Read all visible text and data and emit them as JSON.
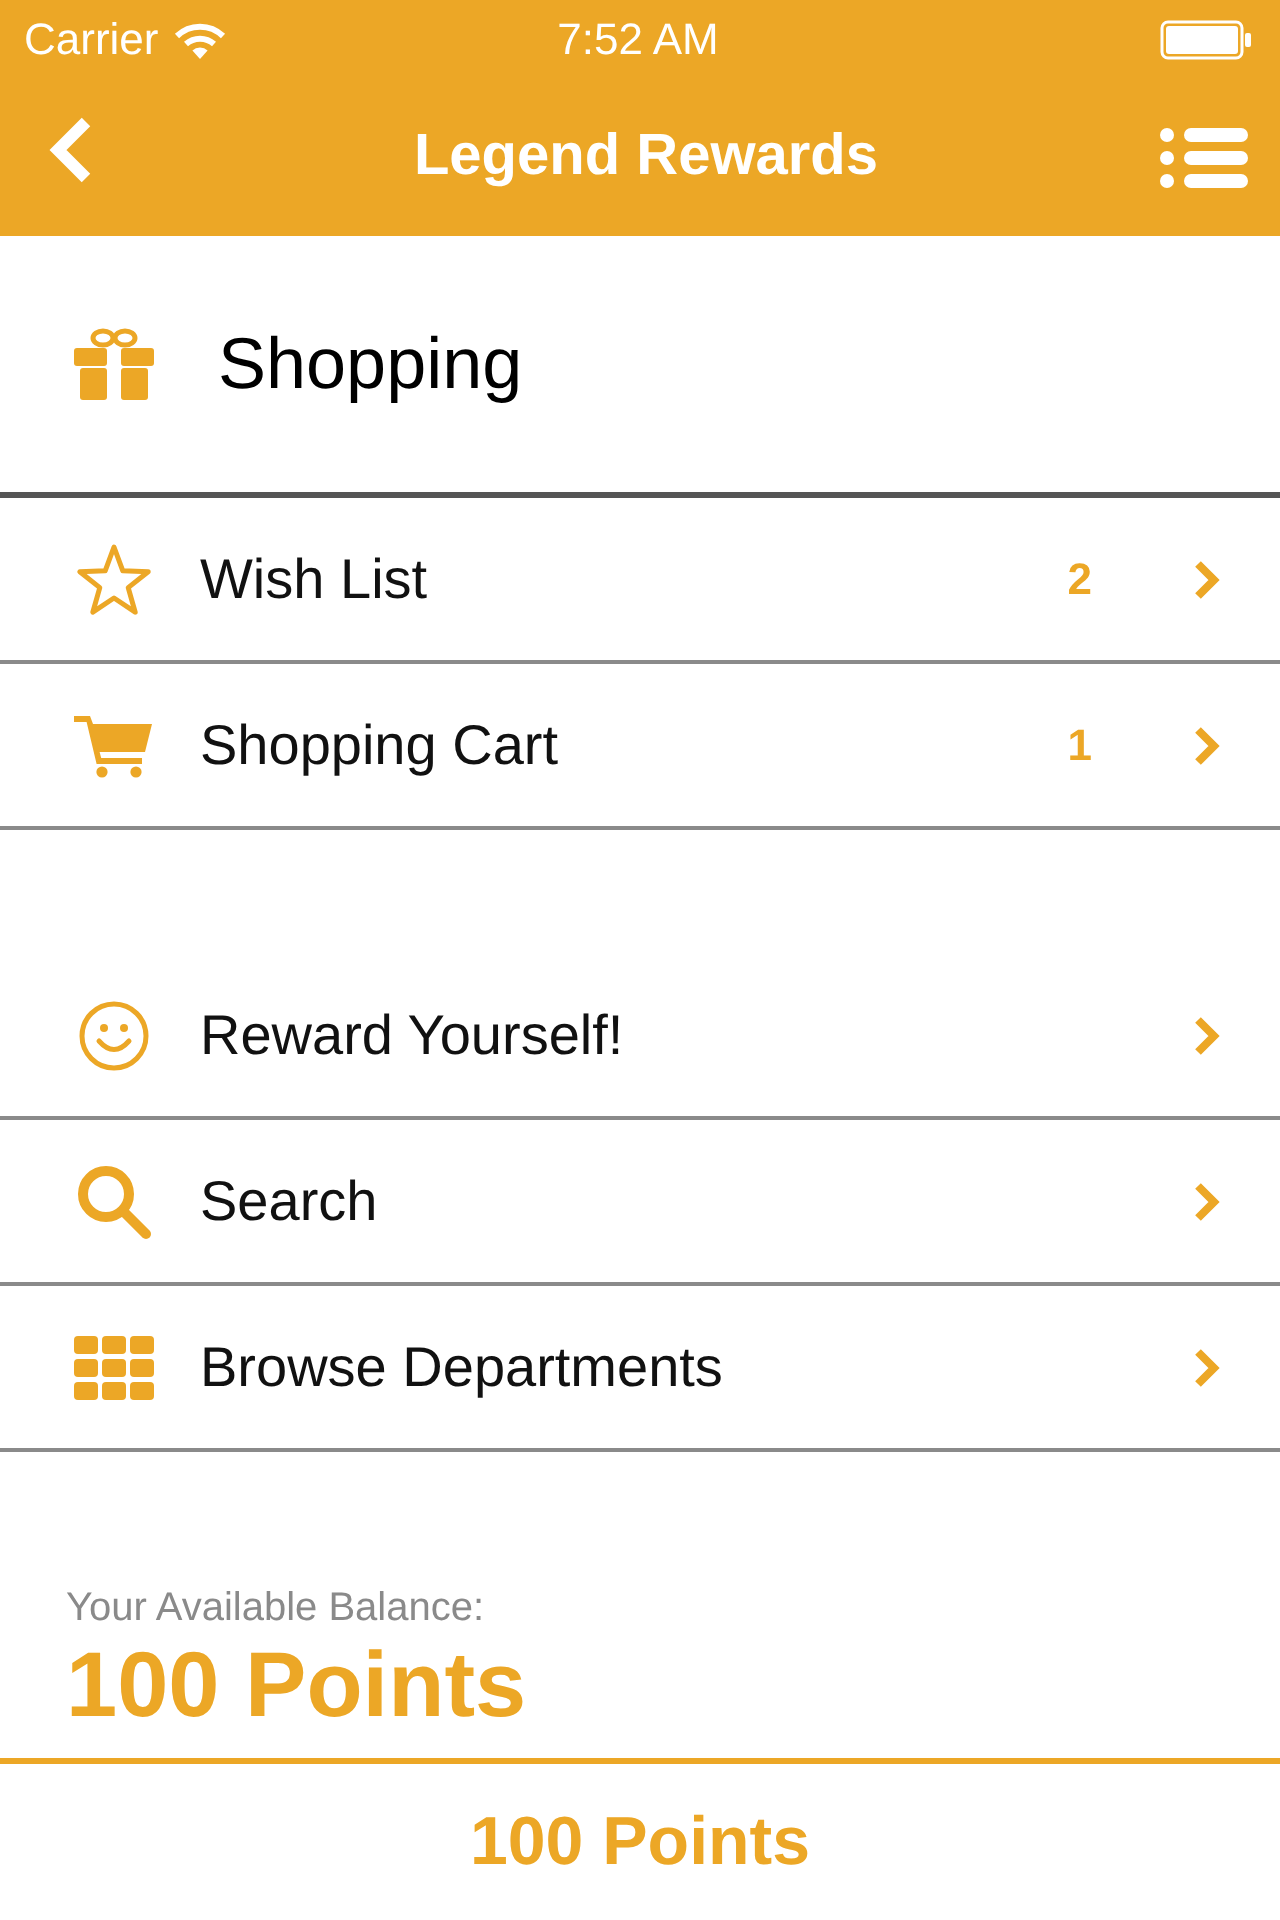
{
  "status_bar": {
    "carrier": "Carrier",
    "time": "7:52 AM"
  },
  "nav": {
    "title": "Legend Rewards"
  },
  "section": {
    "title": "Shopping"
  },
  "groups": [
    {
      "items": [
        {
          "label": "Wish List",
          "count": "2"
        },
        {
          "label": "Shopping Cart",
          "count": "1"
        }
      ]
    },
    {
      "items": [
        {
          "label": "Reward Yourself!"
        },
        {
          "label": "Search"
        },
        {
          "label": "Browse Departments"
        }
      ]
    }
  ],
  "balance": {
    "label": "Your Available Balance:",
    "value": "100 Points"
  },
  "footer": {
    "points": "100 Points"
  }
}
